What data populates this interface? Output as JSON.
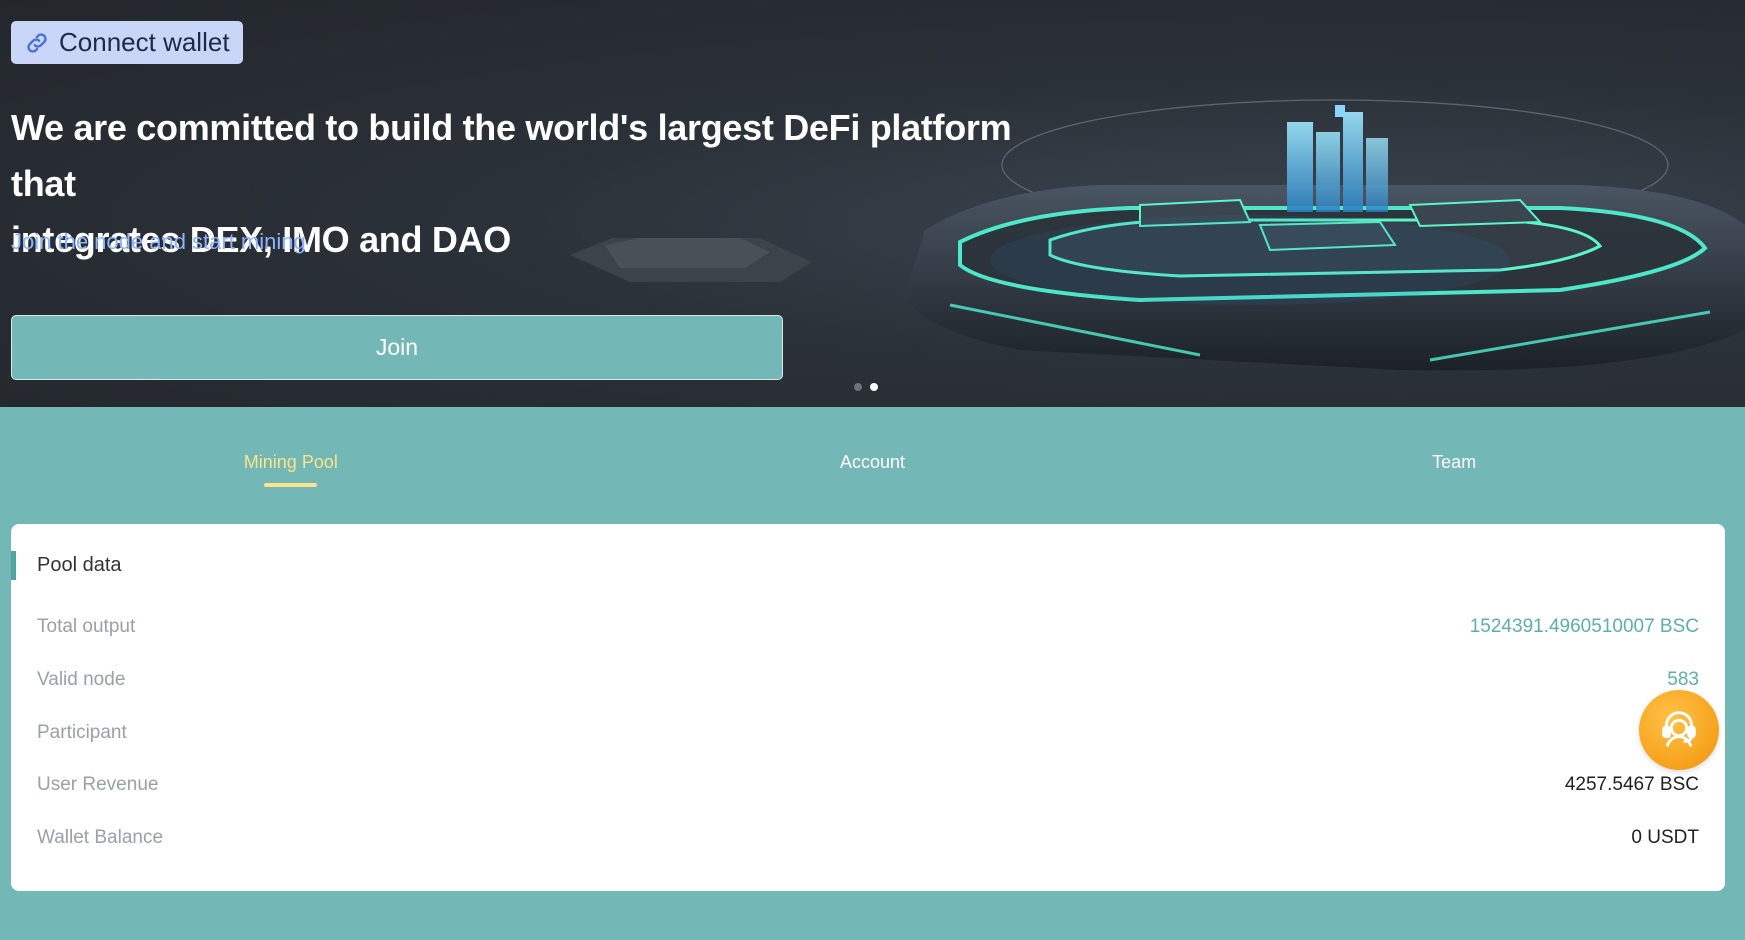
{
  "header": {
    "connect_wallet_label": "Connect wallet"
  },
  "hero": {
    "headline_line1": "We are committed to build the world's largest DeFi platform that",
    "headline_line2": "integrates DEX, IMO and DAO",
    "subline": "Join the node and start mining",
    "join_label": "Join",
    "carousel": {
      "total": 2,
      "active": 2
    }
  },
  "tabs": [
    {
      "label": "Mining Pool",
      "active": true
    },
    {
      "label": "Account",
      "active": false
    },
    {
      "label": "Team",
      "active": false
    }
  ],
  "pool": {
    "title": "Pool data",
    "rows": [
      {
        "label": "Total output",
        "value": "1524391.4960510007 BSC"
      },
      {
        "label": "Valid node",
        "value": "583"
      },
      {
        "label": "Participant",
        "value": ""
      },
      {
        "label": "User Revenue",
        "value": "4257.5467 BSC"
      },
      {
        "label": "Wallet Balance",
        "value": "0 USDT"
      }
    ]
  },
  "colors": {
    "accent": "#73b7b7",
    "active_tab": "#fbe58a",
    "value_teal": "#5bb0ab",
    "support": "#f7a41f"
  },
  "icons": {
    "connect": "link-icon",
    "support": "customer-service-icon"
  }
}
